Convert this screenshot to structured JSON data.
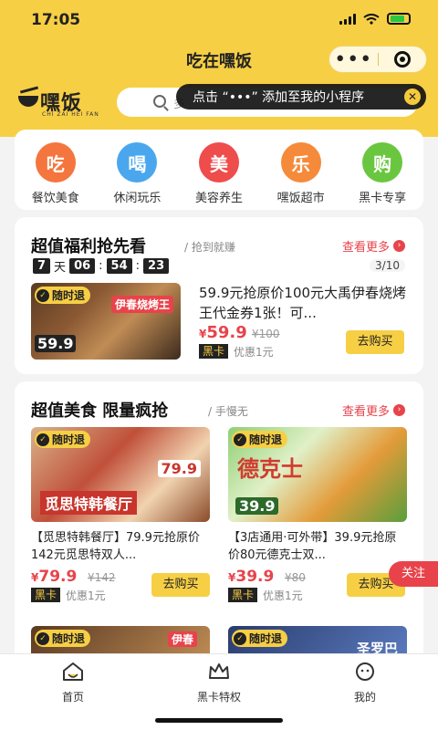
{
  "status_bar": {
    "time": "17:05"
  },
  "header": {
    "title": "吃在嘿饭",
    "more_label": "•••"
  },
  "logo": {
    "name": "嘿饭",
    "pinyin": "CHI ZAI HEI FAN"
  },
  "search": {
    "placeholder": "多"
  },
  "tip": {
    "text": "点击 “•••” 添加至我的小程序",
    "close": "✕"
  },
  "categories": [
    {
      "icon": "吃",
      "label": "餐饮美食",
      "color": "#f4763e"
    },
    {
      "icon": "喝",
      "label": "休闲玩乐",
      "color": "#4aa7ee"
    },
    {
      "icon": "美",
      "label": "美容养生",
      "color": "#ef4c4c"
    },
    {
      "icon": "乐",
      "label": "嘿饭超市",
      "color": "#f58a3a"
    },
    {
      "icon": "购",
      "label": "黑卡专享",
      "color": "#6bc63f"
    }
  ],
  "section1": {
    "title": "超值福利抢先看",
    "subtitle": "/ 抢到就赚",
    "more": "查看更多",
    "countdown": {
      "days": "7",
      "day_label": "天",
      "h": "06",
      "m": "54",
      "s": "23"
    },
    "pager": "3/10",
    "deal": {
      "tag": "随时退",
      "img_text": "伊春烧烤王",
      "img_price": "59.9",
      "title": "59.9元抢原价100元大禹伊春烧烤王代金券1张！可...",
      "price": "59.9",
      "currency": "¥",
      "old_price": "¥100",
      "black_card": "黑卡",
      "discount": "优惠1元",
      "buy": "去购买"
    }
  },
  "section2": {
    "title": "超值美食 限量疯抢",
    "subtitle": "/ 手慢无",
    "more": "查看更多",
    "items": [
      {
        "tag": "随时退",
        "img_text": "觅思特韩餐厅",
        "img_price": "79.9",
        "title": "【觅思特韩餐厅】79.9元抢原价142元觅思特双人...",
        "price": "79.9",
        "currency": "¥",
        "old_price": "¥142",
        "black_card": "黑卡",
        "discount": "优惠1元",
        "buy": "去购买"
      },
      {
        "tag": "随时退",
        "img_text": "德克士",
        "img_price": "39.9",
        "title": "【3店通用·可外带】39.9元抢原价80元德克士双...",
        "price": "39.9",
        "currency": "¥",
        "old_price": "¥80",
        "black_card": "黑卡",
        "discount": "优惠1元",
        "buy": "去购买"
      }
    ],
    "peek": [
      {
        "tag": "随时退",
        "img_text": "伊春"
      },
      {
        "tag": "随时退",
        "img_text": "圣罗巴"
      }
    ]
  },
  "follow": "关注",
  "tabbar": [
    {
      "label": "首页"
    },
    {
      "label": "黑卡特权"
    },
    {
      "label": "我的"
    }
  ]
}
